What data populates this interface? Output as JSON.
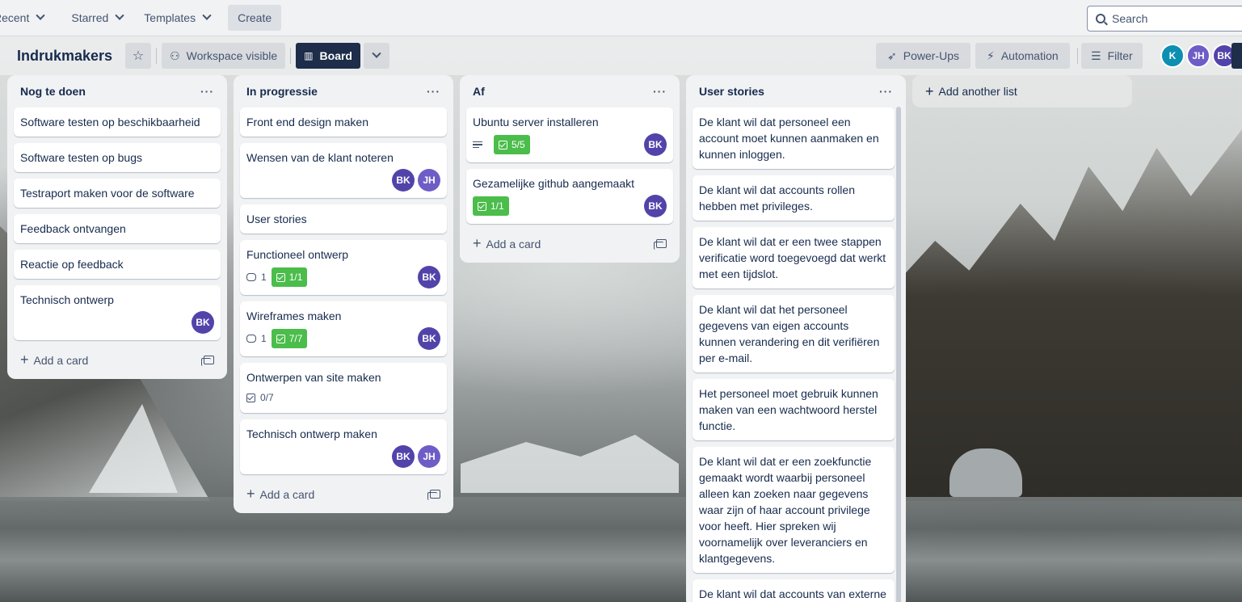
{
  "topnav": {
    "recent": "Recent",
    "starred": "Starred",
    "templates": "Templates",
    "create": "Create",
    "search_placeholder": "Search"
  },
  "board": {
    "title": "Indrukmakers",
    "visibility": "Workspace visible",
    "view": "Board",
    "power_ups": "Power-Ups",
    "automation": "Automation",
    "filter": "Filter",
    "members": [
      "K",
      "JH",
      "BK"
    ]
  },
  "lists": [
    {
      "title": "Nog te doen",
      "cards": [
        {
          "title": "Software testen op beschikbaarheid"
        },
        {
          "title": "Software testen op bugs"
        },
        {
          "title": "Testraport maken voor de software"
        },
        {
          "title": "Feedback ontvangen"
        },
        {
          "title": "Reactie op feedback"
        },
        {
          "title": "Technisch ontwerp",
          "members": [
            "BK"
          ]
        }
      ],
      "add_card": "Add a card"
    },
    {
      "title": "In progressie",
      "cards": [
        {
          "title": "Front end design maken"
        },
        {
          "title": "Wensen van de klant noteren",
          "members": [
            "BK",
            "JH"
          ]
        },
        {
          "title": "User stories"
        },
        {
          "title": "Functioneel ontwerp",
          "comments": "1",
          "checklist": "1/1",
          "members": [
            "BK"
          ]
        },
        {
          "title": "Wireframes maken",
          "comments": "1",
          "checklist": "7/7",
          "members": [
            "BK"
          ]
        },
        {
          "title": "Ontwerpen van site maken",
          "checklist_plain": "0/7"
        },
        {
          "title": "Technisch ontwerp maken",
          "members": [
            "BK",
            "JH"
          ]
        }
      ],
      "add_card": "Add a card"
    },
    {
      "title": "Af",
      "cards": [
        {
          "title": "Ubuntu server installeren",
          "checklist": "5/5",
          "members": [
            "BK"
          ]
        },
        {
          "title": "Gezamelijke github aangemaakt",
          "checklist": "1/1",
          "members": [
            "BK"
          ]
        }
      ],
      "add_card": "Add a card"
    },
    {
      "title": "User stories",
      "cards": [
        {
          "title": "De klant wil dat personeel een account moet kunnen aanmaken en kunnen inloggen."
        },
        {
          "title": "De klant wil dat accounts rollen hebben met privileges."
        },
        {
          "title": "De klant wil dat er een twee stappen verificatie word toegevoegd dat werkt met een tijdslot."
        },
        {
          "title": "De klant wil dat het personeel gegevens van eigen accounts kunnen verandering en dit verifiëren per e-mail."
        },
        {
          "title": "Het personeel moet gebruik kunnen maken van een wachtwoord herstel functie."
        },
        {
          "title": "De klant wil dat er een zoekfunctie gemaakt wordt waarbij personeel alleen kan zoeken naar gegevens waar zijn of haar account privilege voor heeft. Hier spreken wij voornamelijk over leveranciers en klantgegevens."
        },
        {
          "title": "De klant wil dat accounts van externe bedrijven voorzien worden van hun"
        }
      ]
    }
  ],
  "add_list": "Add another list",
  "colors": {
    "avatar_bk": "#5243aa",
    "avatar_jh": "#6e5dc6",
    "avatar_k": "#0c8fb0",
    "checklist_done": "#4bbd4b"
  }
}
